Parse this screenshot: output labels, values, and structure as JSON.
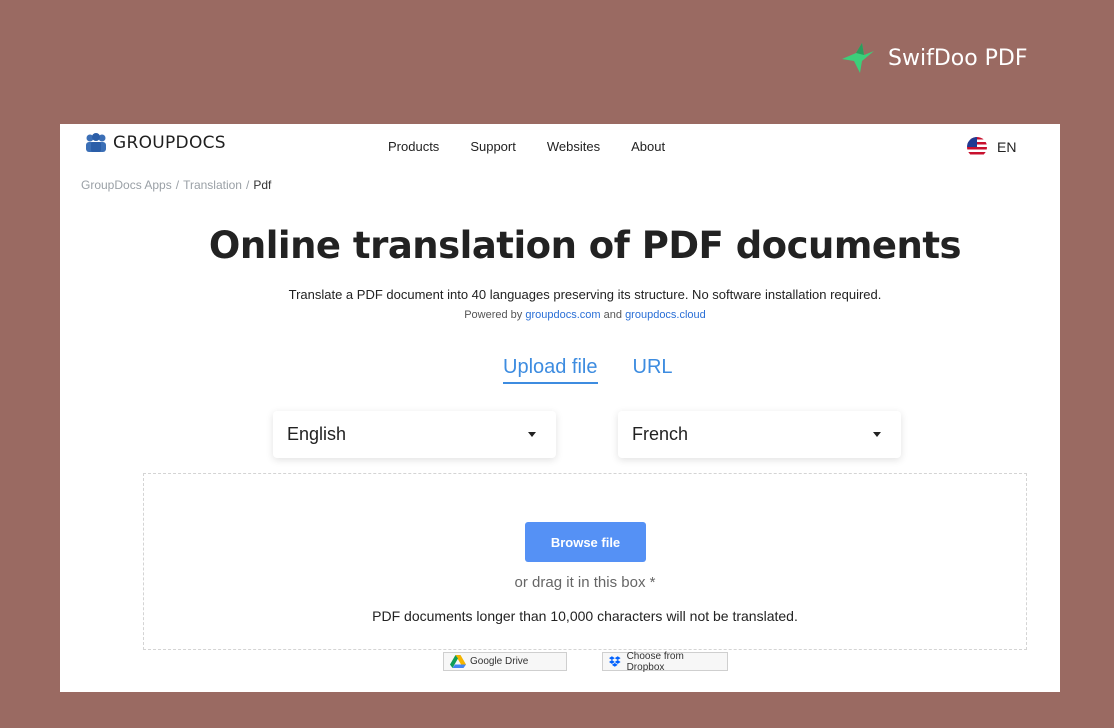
{
  "brand": {
    "name": "SwifDoo PDF",
    "icon": "swifdoo-bird-logo"
  },
  "header": {
    "logo_text": "GROUPDOCS",
    "nav": [
      "Products",
      "Support",
      "Websites",
      "About"
    ],
    "language": "EN"
  },
  "breadcrumb": {
    "items": [
      "GroupDocs Apps",
      "Translation"
    ],
    "current": "Pdf",
    "separator": "/"
  },
  "main": {
    "title": "Online translation of PDF documents",
    "subtitle": "Translate a PDF document into 40 languages preserving its structure. No software installation required.",
    "powered_prefix": "Powered by",
    "powered_link1": "groupdocs.com",
    "powered_and": "and",
    "powered_link2": "groupdocs.cloud",
    "tabs": [
      "Upload file",
      "URL"
    ],
    "source_language": "English",
    "target_language": "French",
    "browse_label": "Browse file",
    "drag_text": "or drag it in this box *",
    "limit_text": "PDF documents longer than 10,000 characters will not be translated.",
    "google_drive_label": "Google Drive",
    "dropbox_label": "Choose from Dropbox"
  },
  "colors": {
    "background": "#9a6a62",
    "accent": "#5591f5",
    "link": "#3d8ce0",
    "brand_green": "#3ccf7a"
  }
}
